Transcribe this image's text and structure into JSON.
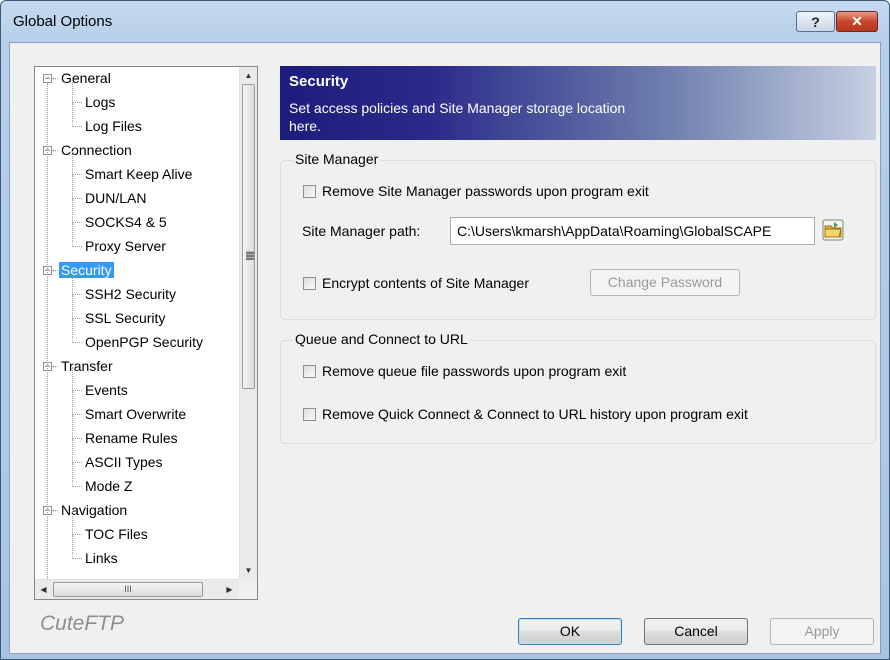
{
  "window": {
    "title": "Global Options",
    "help_glyph": "?",
    "close_glyph": "✕"
  },
  "tree": {
    "items": [
      {
        "label": "General",
        "level": 0,
        "expander": "−"
      },
      {
        "label": "Logs",
        "level": 1
      },
      {
        "label": "Log Files",
        "level": 1
      },
      {
        "label": "Connection",
        "level": 0,
        "expander": "−"
      },
      {
        "label": "Smart Keep Alive",
        "level": 1
      },
      {
        "label": "DUN/LAN",
        "level": 1
      },
      {
        "label": "SOCKS4 & 5",
        "level": 1
      },
      {
        "label": "Proxy Server",
        "level": 1
      },
      {
        "label": "Security",
        "level": 0,
        "expander": "−",
        "selected": true
      },
      {
        "label": "SSH2 Security",
        "level": 1
      },
      {
        "label": "SSL Security",
        "level": 1
      },
      {
        "label": "OpenPGP Security",
        "level": 1
      },
      {
        "label": "Transfer",
        "level": 0,
        "expander": "−"
      },
      {
        "label": "Events",
        "level": 1
      },
      {
        "label": "Smart Overwrite",
        "level": 1
      },
      {
        "label": "Rename Rules",
        "level": 1
      },
      {
        "label": "ASCII Types",
        "level": 1
      },
      {
        "label": "Mode Z",
        "level": 1
      },
      {
        "label": "Navigation",
        "level": 0,
        "expander": "−"
      },
      {
        "label": "TOC Files",
        "level": 1
      },
      {
        "label": "Links",
        "level": 1
      }
    ],
    "hscroll_thumb_glyph": "III"
  },
  "header": {
    "title": "Security",
    "description": "Set access policies and Site Manager storage location here."
  },
  "site_manager": {
    "group_label": "Site Manager",
    "remove_passwords_label": "Remove Site Manager passwords upon program exit",
    "remove_passwords_checked": false,
    "path_label": "Site Manager path:",
    "path_value": "C:\\Users\\kmarsh\\AppData\\Roaming\\GlobalSCAPE",
    "browse_icon": "folder-icon",
    "encrypt_label": "Encrypt contents of Site Manager",
    "encrypt_checked": false,
    "change_password_label": "Change Password"
  },
  "queue": {
    "group_label": "Queue and Connect to URL",
    "remove_queue_label": "Remove queue file passwords upon program exit",
    "remove_queue_checked": false,
    "remove_history_label": "Remove Quick Connect & Connect to URL history upon program exit",
    "remove_history_checked": false
  },
  "footer": {
    "brand": "CuteFTP",
    "ok_label": "OK",
    "cancel_label": "Cancel",
    "apply_label": "Apply"
  },
  "colors": {
    "selection": "#3399ff",
    "header_dark": "#1c1c7c",
    "close_red": "#c9472c"
  }
}
